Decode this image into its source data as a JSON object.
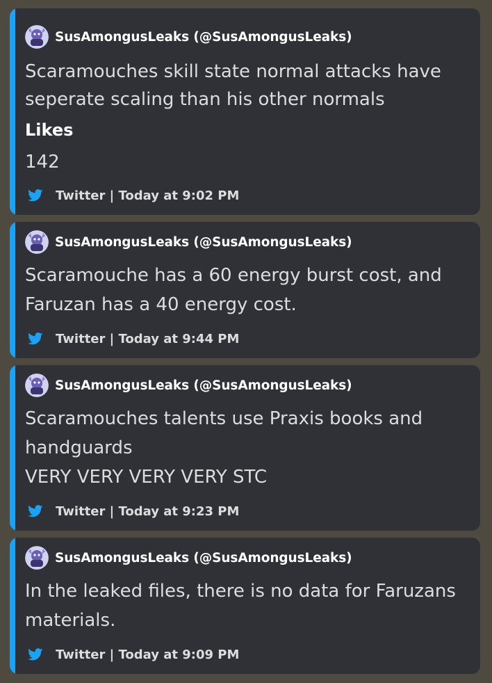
{
  "colors": {
    "background": "#4f4a40",
    "embed_bg": "#2f3136",
    "accent": "#1da1f2",
    "text": "#dcddde",
    "title": "#ffffff"
  },
  "embeds": [
    {
      "author": "SusAmongusLeaks (@SusAmongusLeaks)",
      "avatar_icon": "purple-character-avatar",
      "lines": [
        "Scaramouches skill state normal attacks have",
        "seperate scaling than his other normals"
      ],
      "field": {
        "name": "Likes",
        "value": "142"
      },
      "footer_icon": "twitter-bird-icon",
      "footer": "Twitter | Today at 9:02 PM"
    },
    {
      "author": "SusAmongusLeaks (@SusAmongusLeaks)",
      "avatar_icon": "purple-character-avatar",
      "lines": [
        "Scaramouche has a 60 energy burst cost, and",
        "Faruzan has a 40 energy cost."
      ],
      "footer_icon": "twitter-bird-icon",
      "footer": "Twitter | Today at 9:44 PM"
    },
    {
      "author": "SusAmongusLeaks (@SusAmongusLeaks)",
      "avatar_icon": "purple-character-avatar",
      "lines": [
        "Scaramouches talents use Praxis books and",
        "handguards",
        "VERY VERY VERY VERY STC"
      ],
      "footer_icon": "twitter-bird-icon",
      "footer": "Twitter | Today at 9:23 PM"
    },
    {
      "author": "SusAmongusLeaks (@SusAmongusLeaks)",
      "avatar_icon": "purple-character-avatar",
      "lines": [
        "In the leaked files, there is no data for Faruzans",
        "materials."
      ],
      "footer_icon": "twitter-bird-icon",
      "footer": "Twitter | Today at 9:09 PM"
    }
  ]
}
